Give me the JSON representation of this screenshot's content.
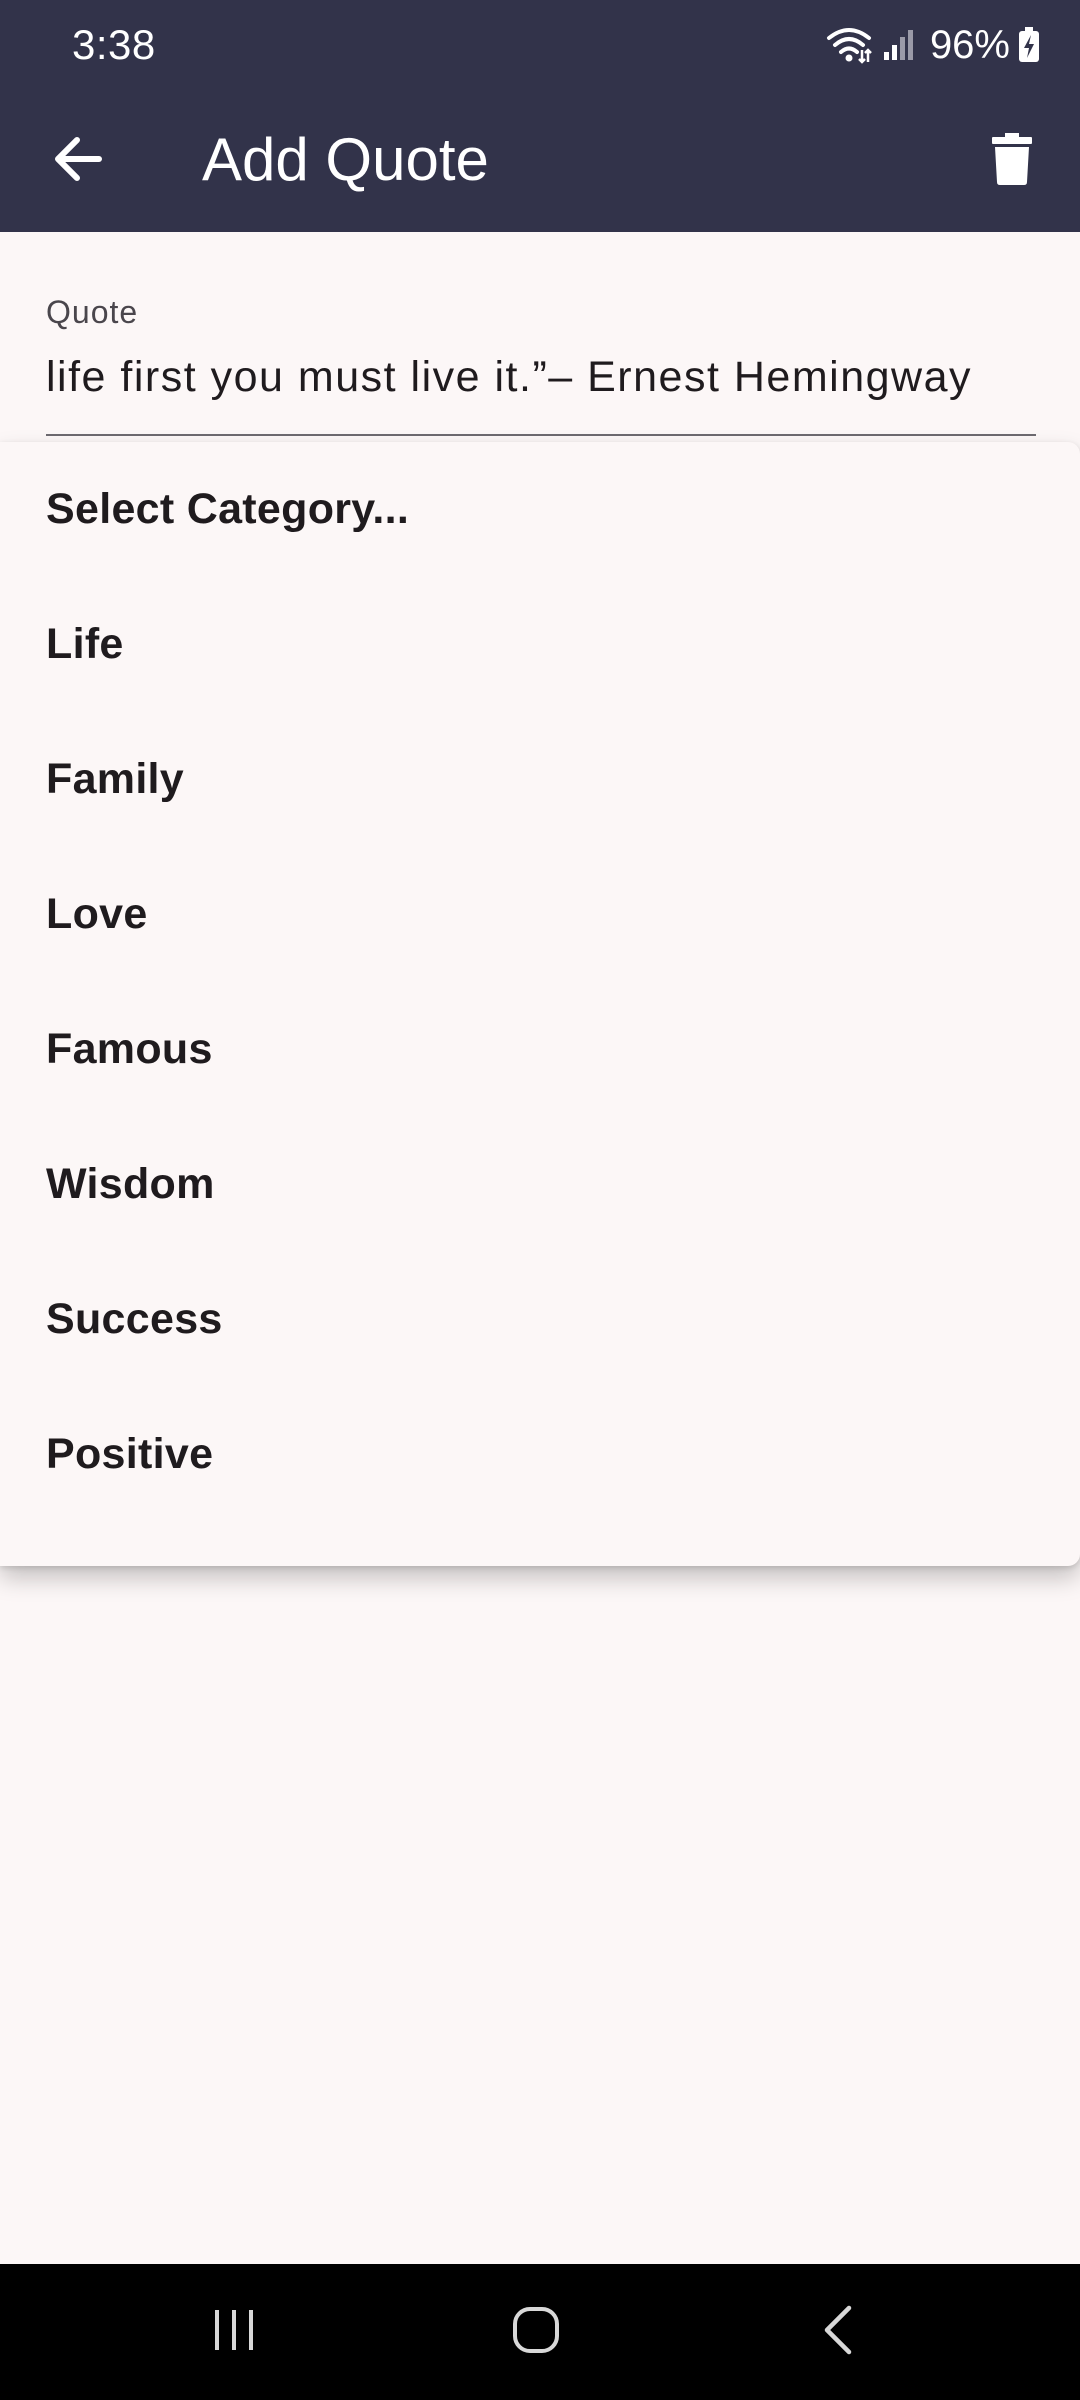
{
  "status_bar": {
    "time": "3:38",
    "battery_percent": "96%",
    "icons": [
      "wifi-icon",
      "signal-icon",
      "battery-charging-icon"
    ]
  },
  "app_bar": {
    "title": "Add Quote",
    "back_icon": "arrow-back-icon",
    "delete_icon": "trash-icon"
  },
  "quote_field": {
    "label": "Quote",
    "value": "life first you must live it.”– Ernest Hemingway"
  },
  "category_menu": {
    "items": [
      "Select Category...",
      "Life",
      "Family",
      "Love",
      "Famous",
      "Wisdom",
      "Success",
      "Positive"
    ]
  },
  "nav_bar": {
    "icons": [
      "recent-apps-icon",
      "home-icon",
      "back-icon"
    ]
  },
  "colors": {
    "app_bar": "#32334a",
    "background": "#fcf7f7",
    "text": "#1f1b1e",
    "nav_bar": "#000000"
  }
}
